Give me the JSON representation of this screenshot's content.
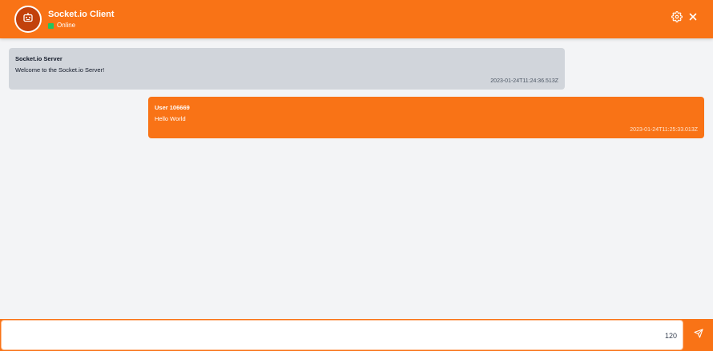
{
  "header": {
    "title": "Socket.io Client",
    "status": "Online",
    "avatar_icon": "robot-icon",
    "settings_icon": "gear-icon",
    "close_icon": "close-icon",
    "accent_color": "#f97316",
    "status_color": "#22c55e"
  },
  "messages": [
    {
      "sender": "Socket.io Server",
      "text": "Welcome to the Socket.io Server!",
      "timestamp": "2023-01-24T11:24:36.513Z",
      "side": "left"
    },
    {
      "sender": "User 106669",
      "text": "Hello World",
      "timestamp": "2023-01-24T11:25:33.013Z",
      "side": "right"
    }
  ],
  "composer": {
    "value": "",
    "char_counter": "120",
    "send_icon": "send-icon"
  }
}
